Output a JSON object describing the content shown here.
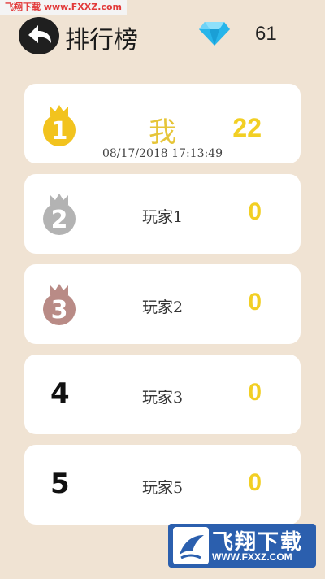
{
  "watermark": {
    "top_text": "飞翔下载 www.FXXZ.com",
    "bottom_title": "飞翔下载",
    "bottom_url": "WWW.FXXZ.COM"
  },
  "header": {
    "title": "排行榜",
    "gems": "61"
  },
  "leaderboard": [
    {
      "rank": "1",
      "name": "我",
      "score": "22",
      "time": "08/17/2018 17:13:49",
      "badge_color": "#f2c31e"
    },
    {
      "rank": "2",
      "name": "玩家1",
      "score": "0",
      "badge_color": "#b3b3b3"
    },
    {
      "rank": "3",
      "name": "玩家2",
      "score": "0",
      "badge_color": "#b98b86"
    },
    {
      "rank": "4",
      "name": "玩家3",
      "score": "0"
    },
    {
      "rank": "5",
      "name": "玩家5",
      "score": "0"
    }
  ],
  "colors": {
    "background": "#f0e3d3",
    "score": "#f2cf24",
    "gem": "#27b5ea"
  }
}
